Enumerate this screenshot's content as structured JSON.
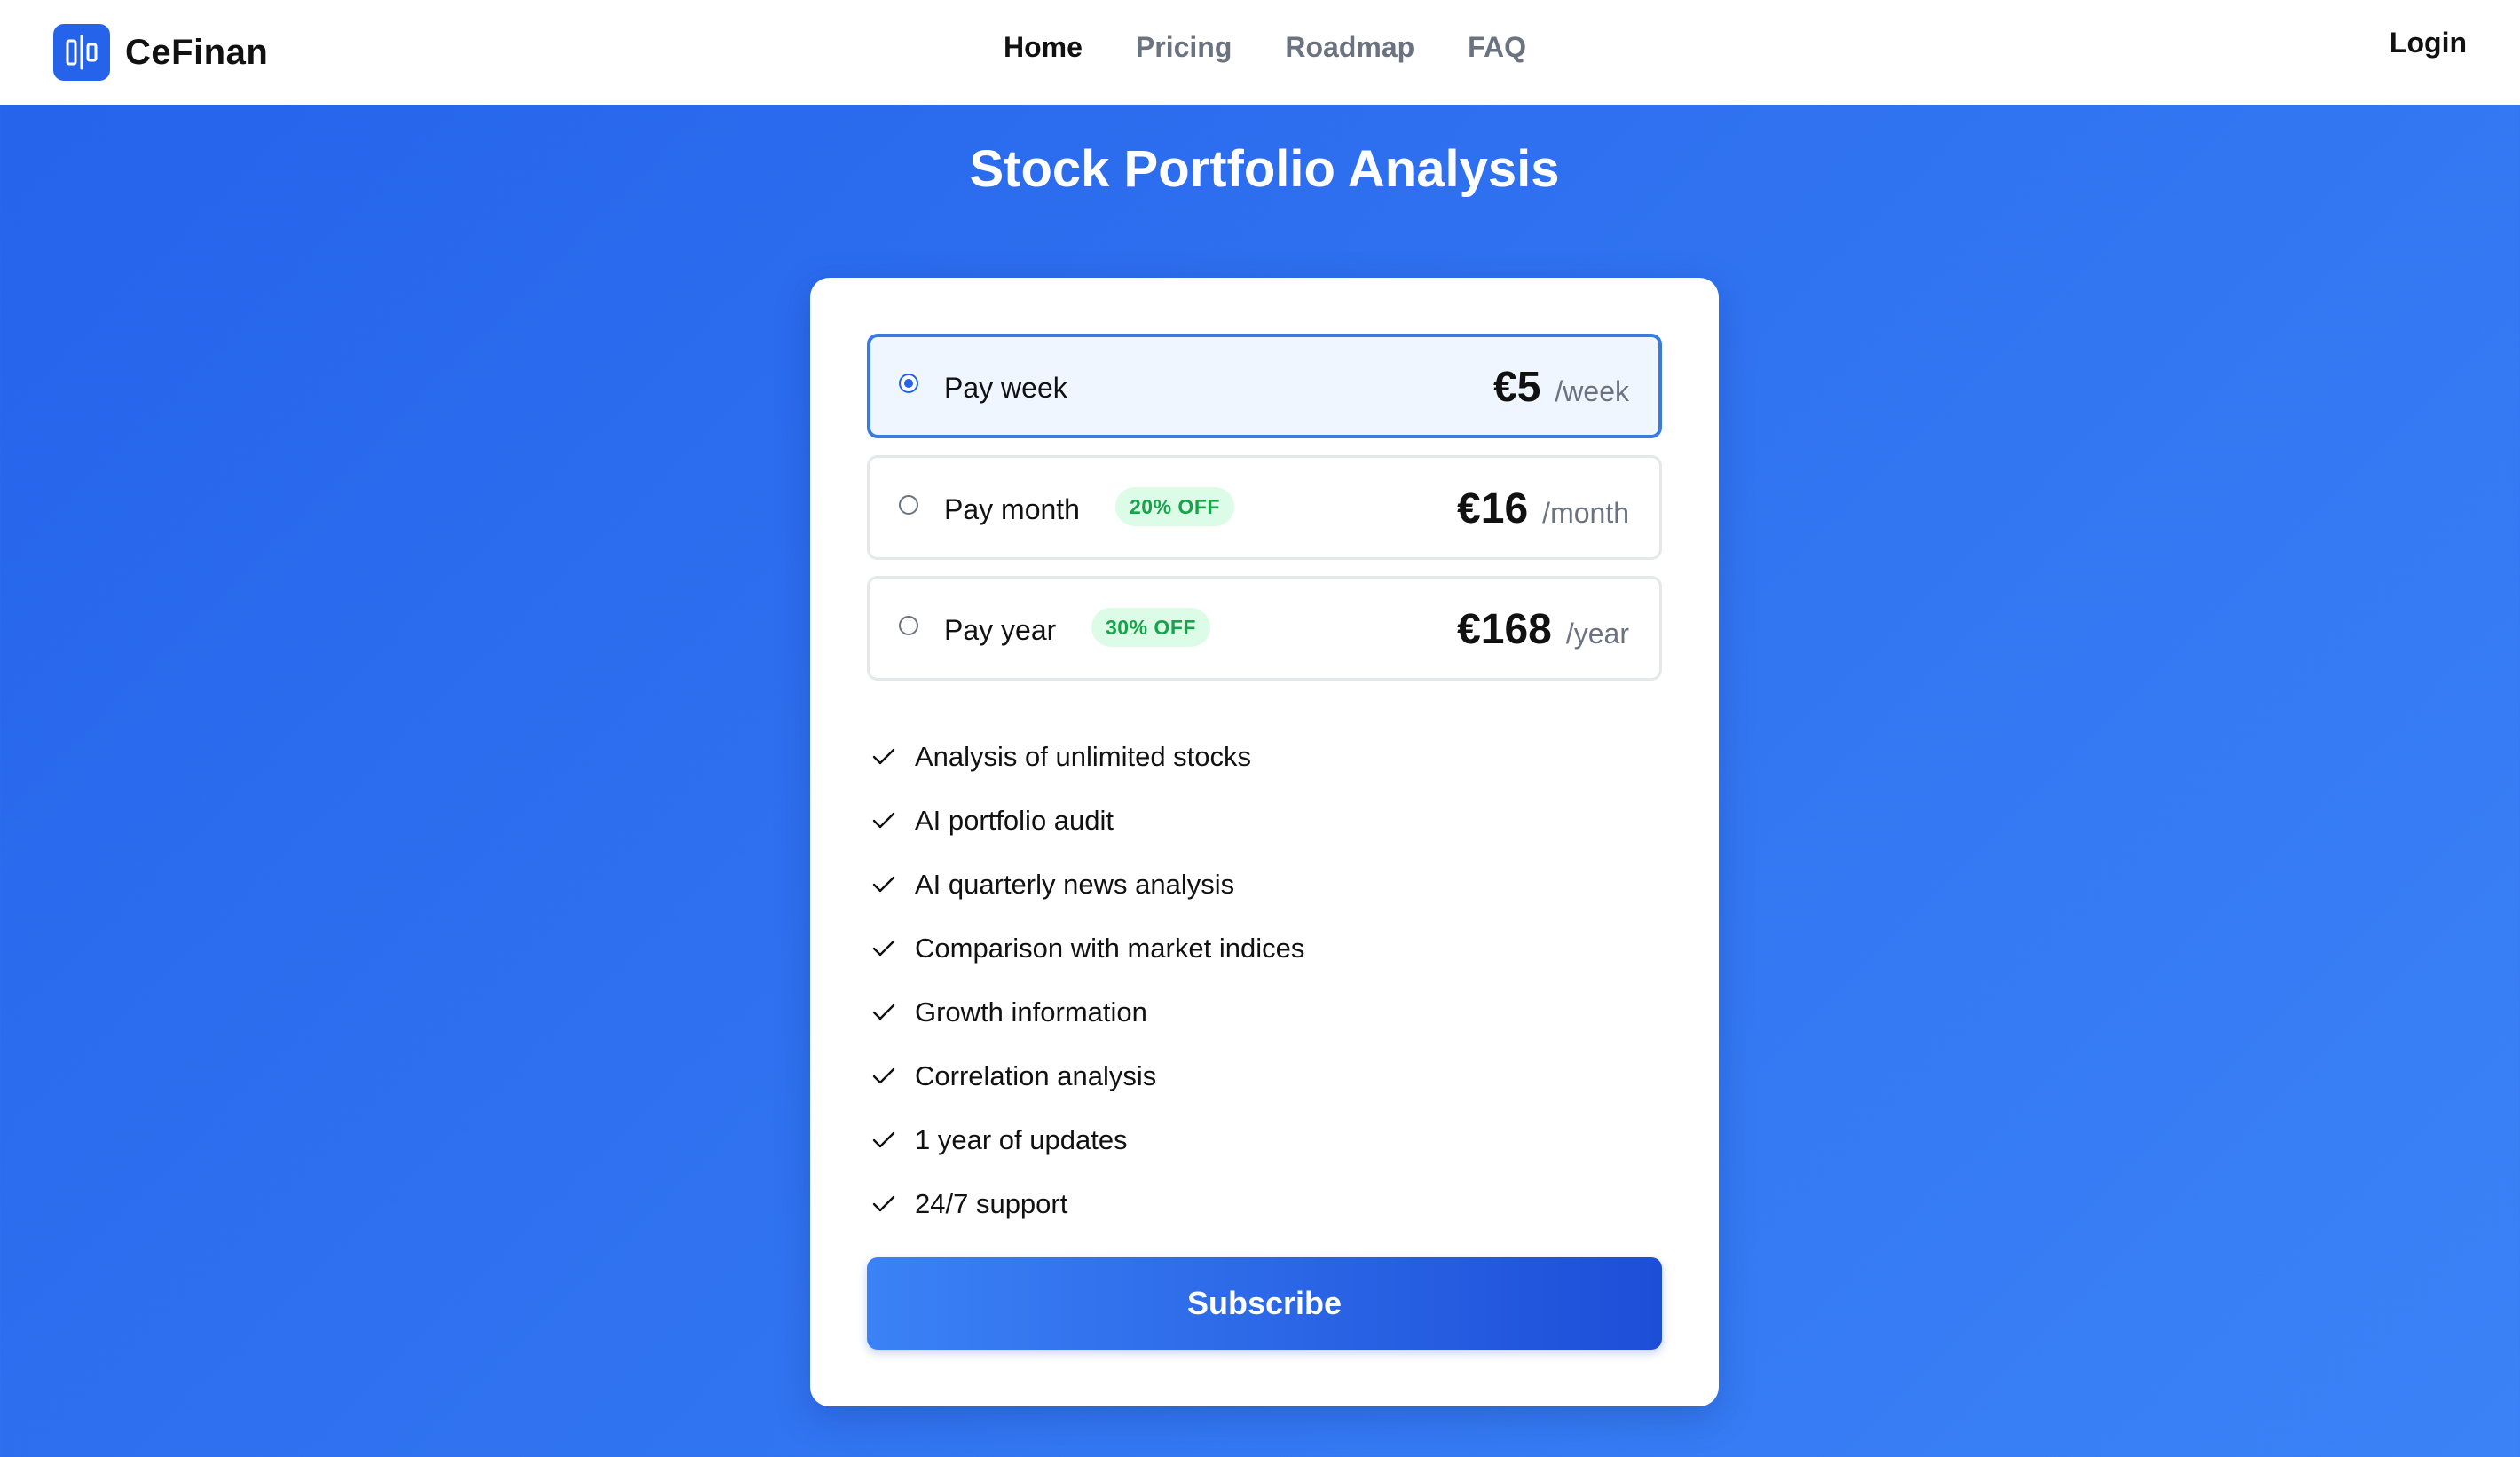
{
  "brand": {
    "name": "CeFinan",
    "logo_icon": "bar-chart-logo-icon",
    "color": "#2563eb"
  },
  "nav": {
    "items": [
      {
        "label": "Home",
        "active": true
      },
      {
        "label": "Pricing",
        "active": false
      },
      {
        "label": "Roadmap",
        "active": false
      },
      {
        "label": "FAQ",
        "active": false
      }
    ],
    "login_label": "Login"
  },
  "page": {
    "title": "Stock Portfolio Analysis"
  },
  "plans": [
    {
      "label": "Pay week",
      "badge": "",
      "price": "€5",
      "period": "/week",
      "selected": true
    },
    {
      "label": "Pay month",
      "badge": "20% OFF",
      "price": "€16",
      "period": "/month",
      "selected": false
    },
    {
      "label": "Pay year",
      "badge": "30% OFF",
      "price": "€168",
      "period": "/year",
      "selected": false
    }
  ],
  "features": [
    "Analysis of unlimited stocks",
    "AI portfolio audit",
    "AI quarterly news analysis",
    "Comparison with market indices",
    "Growth information",
    "Correlation analysis",
    "1 year of updates",
    "24/7 support"
  ],
  "cta": {
    "subscribe_label": "Subscribe"
  },
  "colors": {
    "accent": "#2563eb",
    "badge_bg": "#dcfce7",
    "badge_text": "#16a34a",
    "background_gradient_start": "#2563eb",
    "background_gradient_end": "#3b82f6"
  }
}
